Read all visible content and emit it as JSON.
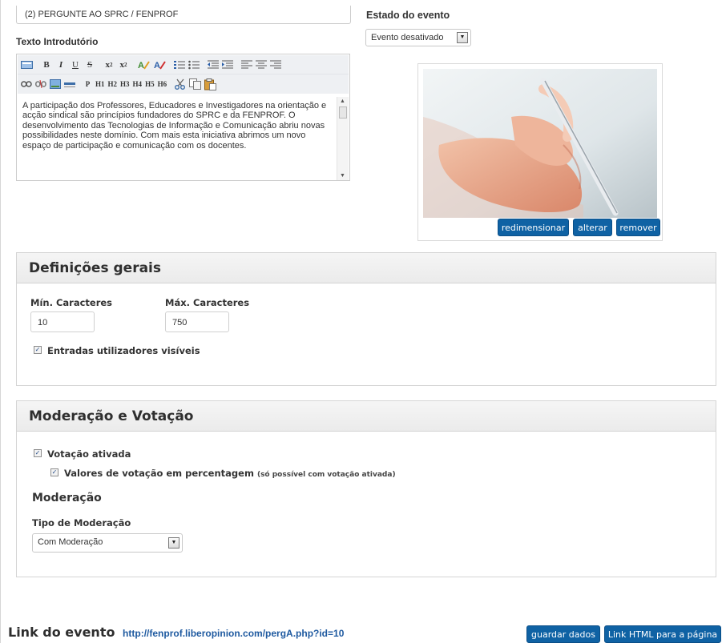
{
  "title_field": {
    "value": "(2) PERGUNTE AO SPRC / FENPROF"
  },
  "intro": {
    "label": "Texto Introdutório",
    "toolbar_row1": [
      "B",
      "I",
      "U",
      "S",
      "x",
      "x",
      "⁞≡",
      "⁞≡",
      "≣",
      "≣",
      "≡",
      "≡",
      "≡"
    ],
    "toolbar_row2": [
      "P",
      "H1",
      "H2",
      "H3",
      "H4",
      "H5",
      "H6"
    ],
    "text": "A participação dos Professores, Educadores e Investigadores na orientação e acção sindical são princípios fundadores do SPRC e da FENPROF. O desenvolvimento das Tecnologias de Informação e Comunicação abriu novas possibilidades neste domínio. Com mais esta iniciativa abrimos um novo espaço de participação e comunicação com os docentes."
  },
  "event_state": {
    "label": "Estado do evento",
    "selected": "Evento desativado"
  },
  "image_buttons": {
    "resize": "redimensionar",
    "change": "alterar",
    "remove": "remover"
  },
  "general": {
    "title": "Definições gerais",
    "min_label": "Mín. Caracteres",
    "min_value": "10",
    "max_label": "Máx. Caracteres",
    "max_value": "750",
    "visible_entries_label": "Entradas utilizadores visíveis",
    "visible_entries_checked": true
  },
  "moderation": {
    "title": "Moderação e Votação",
    "voting_label": "Votação ativada",
    "voting_checked": true,
    "percent_label": "Valores de votação em percentagem",
    "percent_note": "(só possível com votação ativada)",
    "percent_checked": true,
    "subheading": "Moderação",
    "type_label": "Tipo de Moderação",
    "type_selected": "Com Moderação"
  },
  "footer": {
    "link_label": "Link do evento",
    "link_url": "http://fenprof.liberopinion.com/pergA.php?id=10",
    "save_button": "guardar dados",
    "html_link_button": "Link HTML para a página"
  },
  "colors": {
    "primary_button": "#0f62a4",
    "link": "#1f5aa0",
    "panel_header": "#ebebeb"
  }
}
